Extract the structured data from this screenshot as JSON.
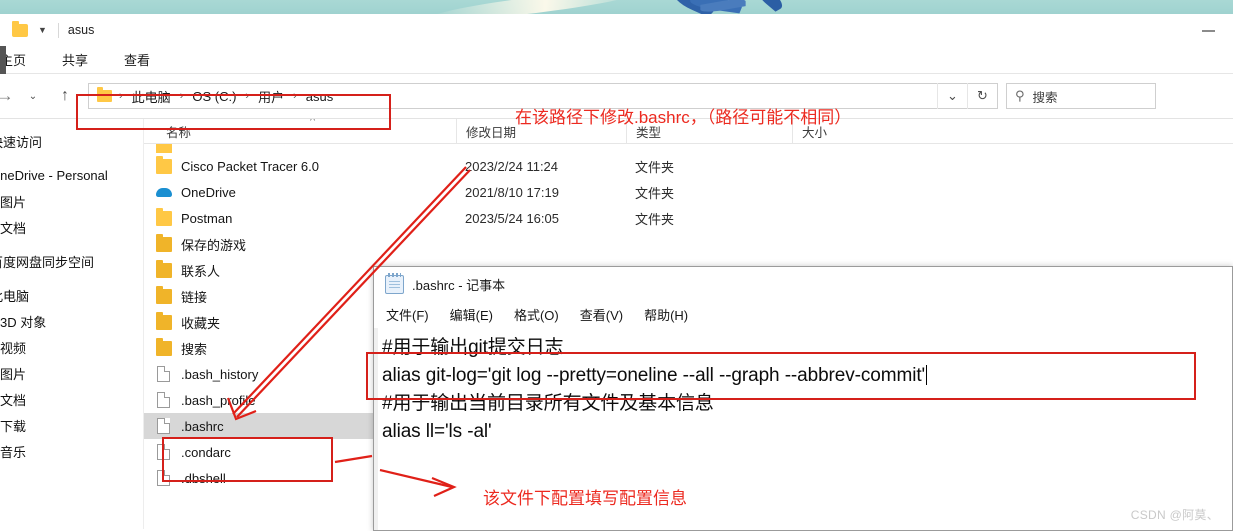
{
  "window": {
    "title": "asus",
    "minimize_label": "—"
  },
  "ribbon": {
    "tabs": [
      "主页",
      "共享",
      "查看"
    ]
  },
  "navbar": {
    "forward_icon": "→",
    "recent_icon": "⌄",
    "up_icon": "↑",
    "breadcrumbs": [
      "此电脑",
      "OS (C:)",
      "用户",
      "asus"
    ],
    "crumb_separator": "›",
    "dropdown_icon": "⌄",
    "refresh_icon": "↻",
    "search_icon": "⚲",
    "search_placeholder": "搜索"
  },
  "sidebar": {
    "items": [
      {
        "label": "快速访问",
        "group": true
      },
      {
        "label": "OneDrive - Personal",
        "group": true
      },
      {
        "label": "图片"
      },
      {
        "label": "文档"
      },
      {
        "label": "百度网盘同步空间",
        "group": true
      },
      {
        "label": "此电脑",
        "group": true
      },
      {
        "label": "3D 对象"
      },
      {
        "label": "视频"
      },
      {
        "label": "图片"
      },
      {
        "label": "文档"
      },
      {
        "label": "下载"
      },
      {
        "label": "音乐"
      }
    ]
  },
  "filelist": {
    "columns": [
      "名称",
      "修改日期",
      "类型",
      "大小"
    ],
    "rows": [
      {
        "name": "",
        "date": "",
        "type": "",
        "size": "",
        "icon": "folder",
        "clipped": true,
        "selected": false
      },
      {
        "name": "Cisco Packet Tracer 6.0",
        "date": "2023/2/24 11:24",
        "type": "文件夹",
        "size": "",
        "icon": "folder",
        "selected": false
      },
      {
        "name": "OneDrive",
        "date": "2021/8/10 17:19",
        "type": "文件夹",
        "size": "",
        "icon": "cloud",
        "selected": false
      },
      {
        "name": "Postman",
        "date": "2023/5/24 16:05",
        "type": "文件夹",
        "size": "",
        "icon": "folder",
        "selected": false
      },
      {
        "name": "保存的游戏",
        "date": "",
        "type": "",
        "size": "",
        "icon": "folder-special",
        "selected": false
      },
      {
        "name": "联系人",
        "date": "",
        "type": "",
        "size": "",
        "icon": "folder-contacts",
        "selected": false
      },
      {
        "name": "链接",
        "date": "",
        "type": "",
        "size": "",
        "icon": "folder-links",
        "selected": false
      },
      {
        "name": "收藏夹",
        "date": "",
        "type": "",
        "size": "",
        "icon": "folder-fav",
        "selected": false
      },
      {
        "name": "搜索",
        "date": "",
        "type": "",
        "size": "",
        "icon": "folder-search",
        "selected": false
      },
      {
        "name": ".bash_history",
        "date": "",
        "type": "",
        "size": "",
        "icon": "file",
        "selected": false
      },
      {
        "name": ".bash_profile",
        "date": "",
        "type": "",
        "size": "",
        "icon": "file",
        "selected": false
      },
      {
        "name": ".bashrc",
        "date": "",
        "type": "",
        "size": "",
        "icon": "file",
        "selected": true
      },
      {
        "name": ".condarc",
        "date": "",
        "type": "",
        "size": "",
        "icon": "file",
        "selected": false
      },
      {
        "name": ".dbshell",
        "date": "",
        "type": "",
        "size": "",
        "icon": "file",
        "selected": false
      }
    ]
  },
  "notepad": {
    "title": ".bashrc - 记事本",
    "menus": [
      "文件(F)",
      "编辑(E)",
      "格式(O)",
      "查看(V)",
      "帮助(H)"
    ],
    "lines": [
      "#用于输出git提交日志",
      "alias git-log='git log --pretty=oneline --all --graph --abbrev-commit'",
      "#用于输出当前目录所有文件及基本信息",
      "alias ll='ls -al'"
    ]
  },
  "annotations": {
    "path_note": "在该路径下修改.bashrc，（路径可能不相同）",
    "file_note": "该文件下配置填写配置信息",
    "color": "#e8231b"
  },
  "watermark": "CSDN @阿莫、"
}
